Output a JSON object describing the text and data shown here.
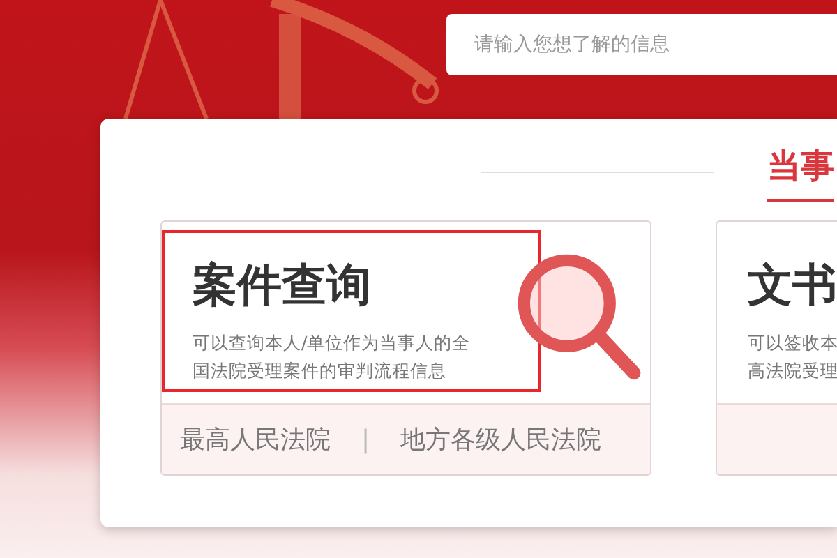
{
  "search": {
    "placeholder": "请输入您想了解的信息"
  },
  "section_tab": {
    "label": "当事",
    "selected": true
  },
  "cards": [
    {
      "title": "案件查询",
      "description_lines": [
        "可以查询本人/单位作为当事人的全",
        "国法院受理案件的审判流程信息"
      ],
      "highlighted": true,
      "links": [
        "最高人民法院",
        "地方各级人民法院"
      ],
      "link_separator": "|"
    },
    {
      "title": "文书",
      "description_lines": [
        "可以签收本",
        "高法院受理"
      ],
      "highlighted": false
    }
  ]
}
